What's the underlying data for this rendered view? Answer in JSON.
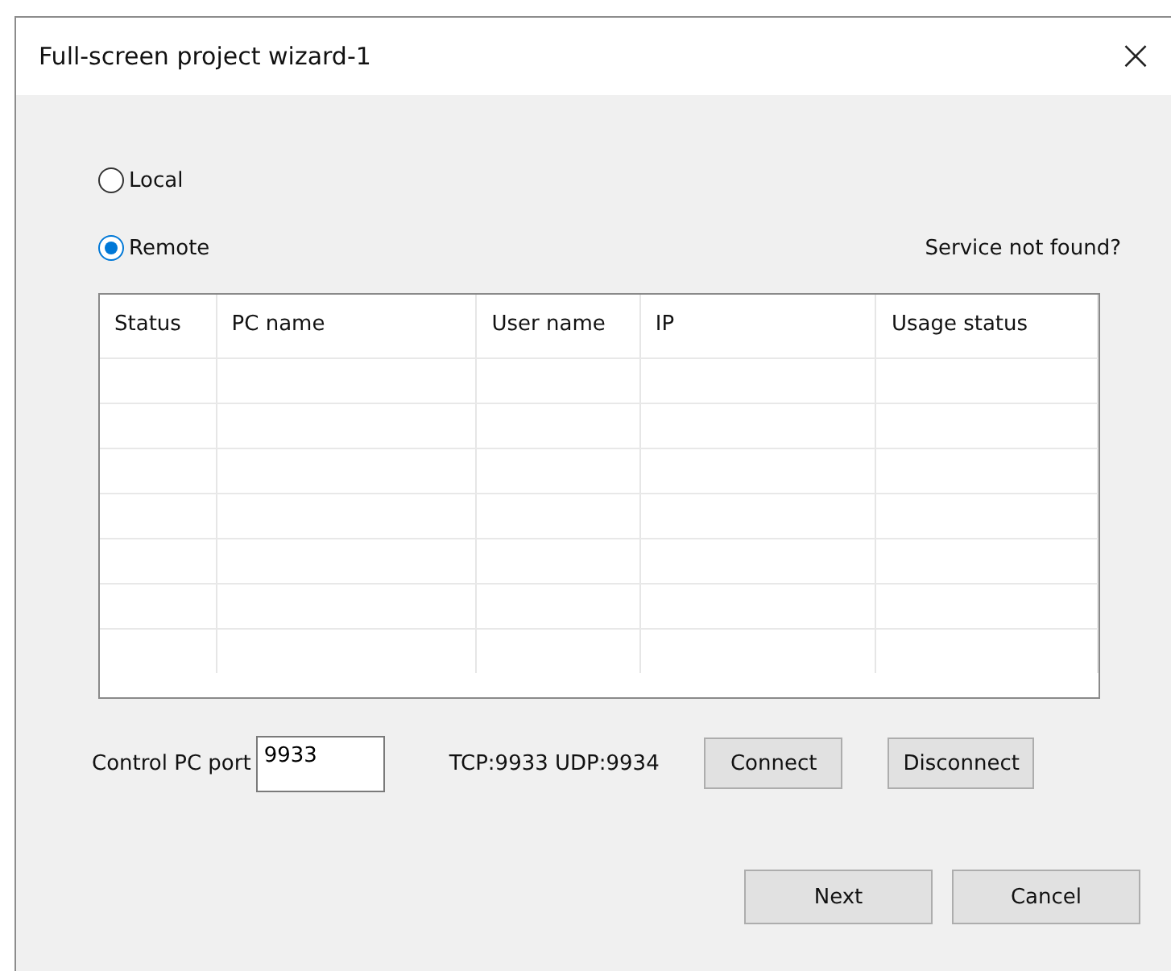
{
  "window": {
    "title": "Full-screen project wizard-1",
    "close": "×"
  },
  "modes": [
    {
      "label": "Local",
      "selected": false
    },
    {
      "label": "Remote",
      "selected": true
    }
  ],
  "help_link": "Service not found?",
  "table": {
    "columns": [
      "Status",
      "PC name",
      "User name",
      "IP",
      "Usage status"
    ]
  },
  "port": {
    "label": "Control PC port",
    "value": "9933",
    "protocols": "TCP:9933 UDP:9934"
  },
  "connection_buttons": [
    "Connect",
    "Disconnect"
  ],
  "footer_buttons": [
    "Next",
    "Cancel"
  ]
}
